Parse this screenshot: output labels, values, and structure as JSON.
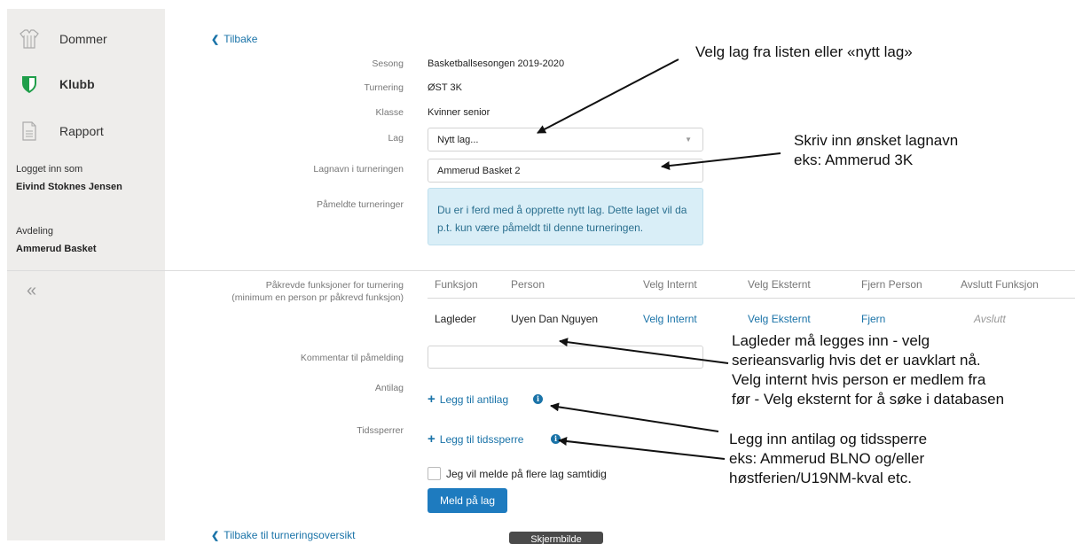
{
  "sidebar": {
    "items": [
      {
        "label": "Dommer",
        "icon": "referee-shirt-icon"
      },
      {
        "label": "Klubb",
        "icon": "shield-icon"
      },
      {
        "label": "Rapport",
        "icon": "document-icon"
      }
    ],
    "logged_in_label": "Logget inn som",
    "user_name": "Eivind Stoknes Jensen",
    "department_label": "Avdeling",
    "department_name": "Ammerud Basket",
    "collapse_glyph": "«"
  },
  "form": {
    "back_link": "Tilbake",
    "season": {
      "label": "Sesong",
      "value": "Basketballsesongen 2019-2020"
    },
    "tournament": {
      "label": "Turnering",
      "value": "ØST 3K"
    },
    "class": {
      "label": "Klasse",
      "value": "Kvinner senior"
    },
    "team": {
      "label": "Lag",
      "value": "Nytt lag..."
    },
    "team_name": {
      "label": "Lagnavn i turneringen",
      "value": "Ammerud Basket 2"
    },
    "registered": {
      "label": "Påmeldte turneringer",
      "info": "Du er i ferd med å opprette nytt lag. Dette laget vil da p.t. kun være påmeldt til denne turneringen."
    },
    "functions": {
      "label_line1": "Påkrevde funksjoner for turnering",
      "label_line2": "(minimum en person pr påkrevd funksjon)",
      "headers": [
        "Funksjon",
        "Person",
        "Velg Internt",
        "Velg Eksternt",
        "Fjern Person",
        "Avslutt Funksjon"
      ],
      "row": {
        "function": "Lagleder",
        "person": "Uyen Dan Nguyen",
        "internal": "Velg Internt",
        "external": "Velg Eksternt",
        "remove": "Fjern",
        "finish": "Avslutt"
      }
    },
    "comment": {
      "label": "Kommentar til påmelding",
      "value": ""
    },
    "antilag": {
      "label": "Antilag",
      "link": "Legg til antilag"
    },
    "time_blocks": {
      "label": "Tidssperrer",
      "link": "Legg til tidssperre"
    },
    "multi_checkbox": "Jeg vil melde på flere lag samtidig",
    "submit": "Meld på lag",
    "back_overview": "Tilbake til turneringsoversikt",
    "tooltip": "Skjermbilde"
  },
  "annotations": {
    "select_team": "Velg lag fra listen eller «nytt lag»",
    "team_name_line1": "Skriv inn ønsket lagnavn",
    "team_name_line2": "eks: Ammerud 3K",
    "leader": [
      "Lagleder må legges inn - velg",
      "serieansvarlig hvis det er uavklart nå.",
      "Velg internt hvis person er medlem fra",
      "før - Velg eksternt for å søke i databasen"
    ],
    "antilag": [
      "Legg inn antilag og tidssperre",
      "eks: Ammerud BLNO og/eller",
      "høstferien/U19NM-kval etc."
    ]
  },
  "colors": {
    "link": "#1a73a8",
    "primary_button": "#1e7bbf",
    "info_bg": "#d9eef7",
    "shield_green": "#1f9e4a",
    "sidebar_bg": "#eeedeb"
  }
}
